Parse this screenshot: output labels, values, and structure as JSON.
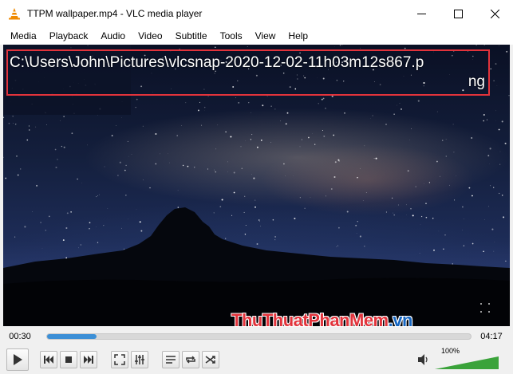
{
  "window": {
    "title": "TTPM wallpaper.mp4 - VLC media player"
  },
  "menu": [
    "Media",
    "Playback",
    "Audio",
    "Video",
    "Subtitle",
    "Tools",
    "View",
    "Help"
  ],
  "osd": {
    "path_main": "C:\\Users\\John\\Pictures\\vlcsnap-2020-12-02-11h03m12s867.p",
    "path_tail": "ng"
  },
  "watermark": {
    "part1": "ThuThuat",
    "part2": "PhanMem",
    "part3": ".vn"
  },
  "playback": {
    "elapsed": "00:30",
    "total": "04:17",
    "progress": 0.117
  },
  "volume": {
    "label": "100%",
    "level": 1.0
  },
  "colors": {
    "accent": "#3c8fd6",
    "highlight": "#e2333b",
    "volume": "#3aa33a"
  }
}
